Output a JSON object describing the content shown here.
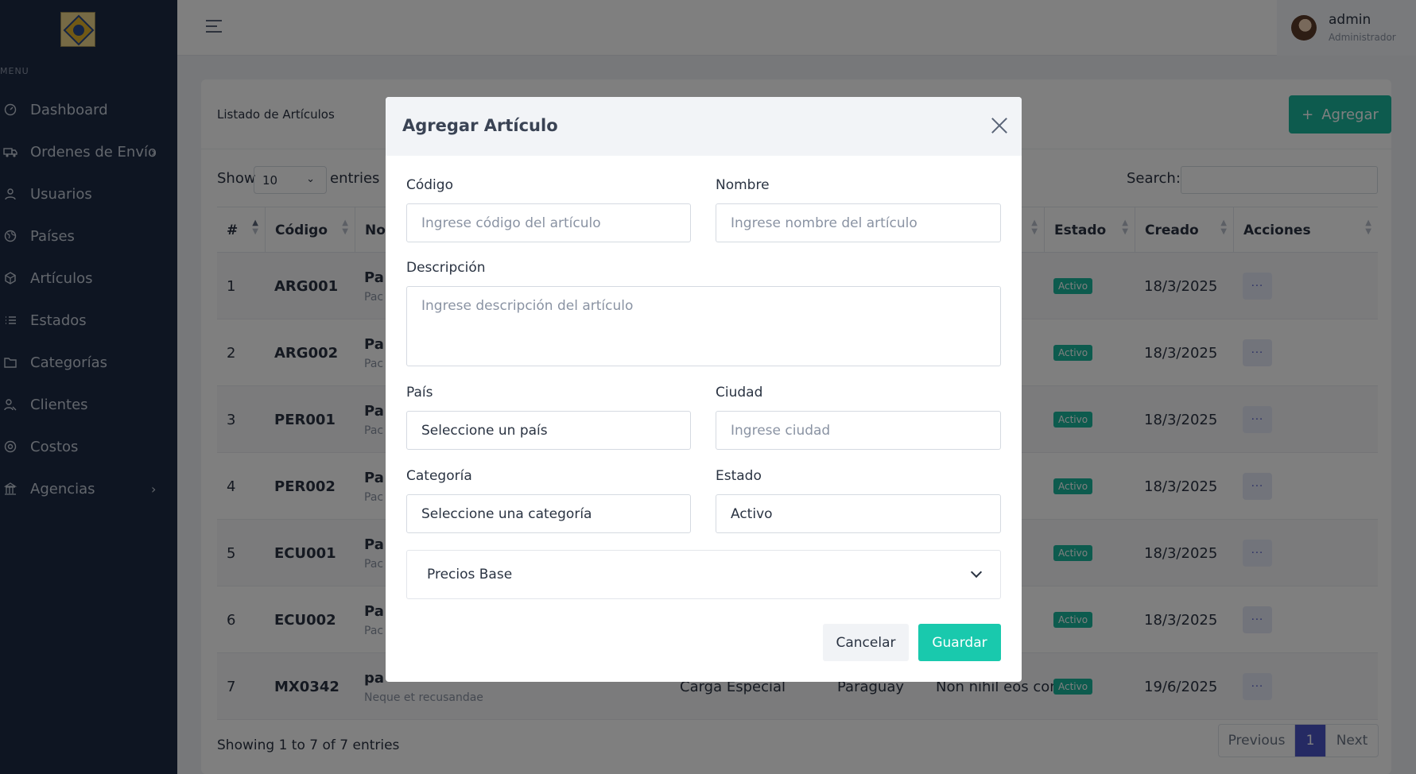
{
  "sidebar": {
    "menu_label": "MENU",
    "items": [
      {
        "label": "Dashboard",
        "icon": "dashboard-icon"
      },
      {
        "label": "Ordenes de Envío",
        "icon": "truck-icon"
      },
      {
        "label": "Usuarios",
        "icon": "user-icon"
      },
      {
        "label": "Países",
        "icon": "globe-icon"
      },
      {
        "label": "Artículos",
        "icon": "box-icon"
      },
      {
        "label": "Estados",
        "icon": "list-icon"
      },
      {
        "label": "Categorías",
        "icon": "folder-icon"
      },
      {
        "label": "Clientes",
        "icon": "clients-icon"
      },
      {
        "label": "Costos",
        "icon": "dollar-icon"
      },
      {
        "label": "Agencias",
        "icon": "bank-icon"
      }
    ]
  },
  "topbar": {
    "user_name": "admin",
    "user_role": "Administrador"
  },
  "card": {
    "title": "Listado de Artículos",
    "add_label": "Agregar",
    "show_label": "Show",
    "show_value": "10",
    "entries_label": "entries",
    "search_label": "Search:",
    "columns": [
      "#",
      "Código",
      "No",
      "Estado",
      "Creado",
      "Acciones"
    ],
    "rows": [
      {
        "num": "1",
        "code": "ARG001",
        "name": "Pa",
        "desc": "Pac",
        "status": "Activo",
        "created": "18/3/2025"
      },
      {
        "num": "2",
        "code": "ARG002",
        "name": "Pa",
        "desc": "Pac",
        "status": "Activo",
        "created": "18/3/2025"
      },
      {
        "num": "3",
        "code": "PER001",
        "name": "Pa",
        "desc": "Pac",
        "status": "Activo",
        "created": "18/3/2025"
      },
      {
        "num": "4",
        "code": "PER002",
        "name": "Pa",
        "desc": "Pac",
        "status": "Activo",
        "created": "18/3/2025"
      },
      {
        "num": "5",
        "code": "ECU001",
        "name": "Pa",
        "desc": "Pac",
        "status": "Activo",
        "created": "18/3/2025"
      },
      {
        "num": "6",
        "code": "ECU002",
        "name": "Pa",
        "desc": "Pac",
        "status": "Activo",
        "created": "18/3/2025"
      },
      {
        "num": "7",
        "code": "MX0342",
        "name": "pa",
        "desc": "Neque et recusandae",
        "category": "Carga Especial",
        "country": "Paraguay",
        "city": "Non nihil eos consec",
        "status": "Activo",
        "created": "19/6/2025"
      }
    ],
    "actions_label": "···",
    "showing": "Showing 1 to 7 of 7 entries",
    "pager": {
      "prev": "Previous",
      "page": "1",
      "next": "Next"
    }
  },
  "modal": {
    "title": "Agregar Artículo",
    "codigo_label": "Código",
    "codigo_placeholder": "Ingrese código del artículo",
    "nombre_label": "Nombre",
    "nombre_placeholder": "Ingrese nombre del artículo",
    "descripcion_label": "Descripción",
    "descripcion_placeholder": "Ingrese descripción del artículo",
    "pais_label": "País",
    "pais_value": "Seleccione un país",
    "ciudad_label": "Ciudad",
    "ciudad_placeholder": "Ingrese ciudad",
    "categoria_label": "Categoría",
    "categoria_value": "Seleccione una categoría",
    "estado_label": "Estado",
    "estado_value": "Activo",
    "precios_label": "Precios Base",
    "cancel_label": "Cancelar",
    "save_label": "Guardar"
  },
  "colors": {
    "accent": "#1bb69c",
    "save": "#19c9ad",
    "primary": "#4b55c7",
    "sidebar": "#1d2a44"
  }
}
